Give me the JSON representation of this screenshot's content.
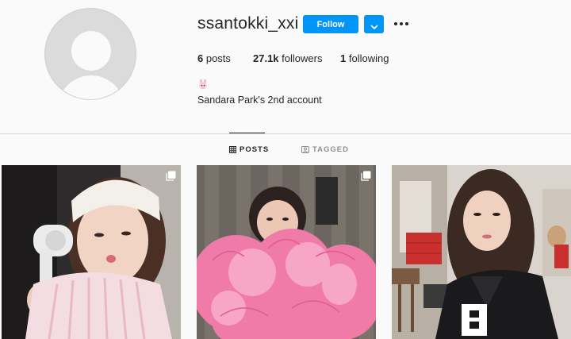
{
  "profile": {
    "username": "ssantokki_xxi",
    "follow_label": "Follow",
    "bio": "Sandara Park's 2nd account",
    "bio_icon": "rabbit-emoji-icon"
  },
  "stats": {
    "posts_count": "6",
    "posts_label": " posts",
    "followers_count": "27.1k",
    "followers_label": " followers",
    "following_count": "1",
    "following_label": " following"
  },
  "tabs": [
    {
      "label": "POSTS",
      "icon": "grid-icon",
      "active": true
    },
    {
      "label": "TAGGED",
      "icon": "tag-icon",
      "active": false
    }
  ],
  "posts": [
    {
      "description_icon": "carousel-icon"
    },
    {
      "description_icon": "carousel-icon"
    },
    {
      "description_icon": "none"
    }
  ],
  "colors": {
    "accent": "#0095f6",
    "background": "#fafafa",
    "divider": "#dbdbdb",
    "muted_text": "#8e8e8e"
  }
}
